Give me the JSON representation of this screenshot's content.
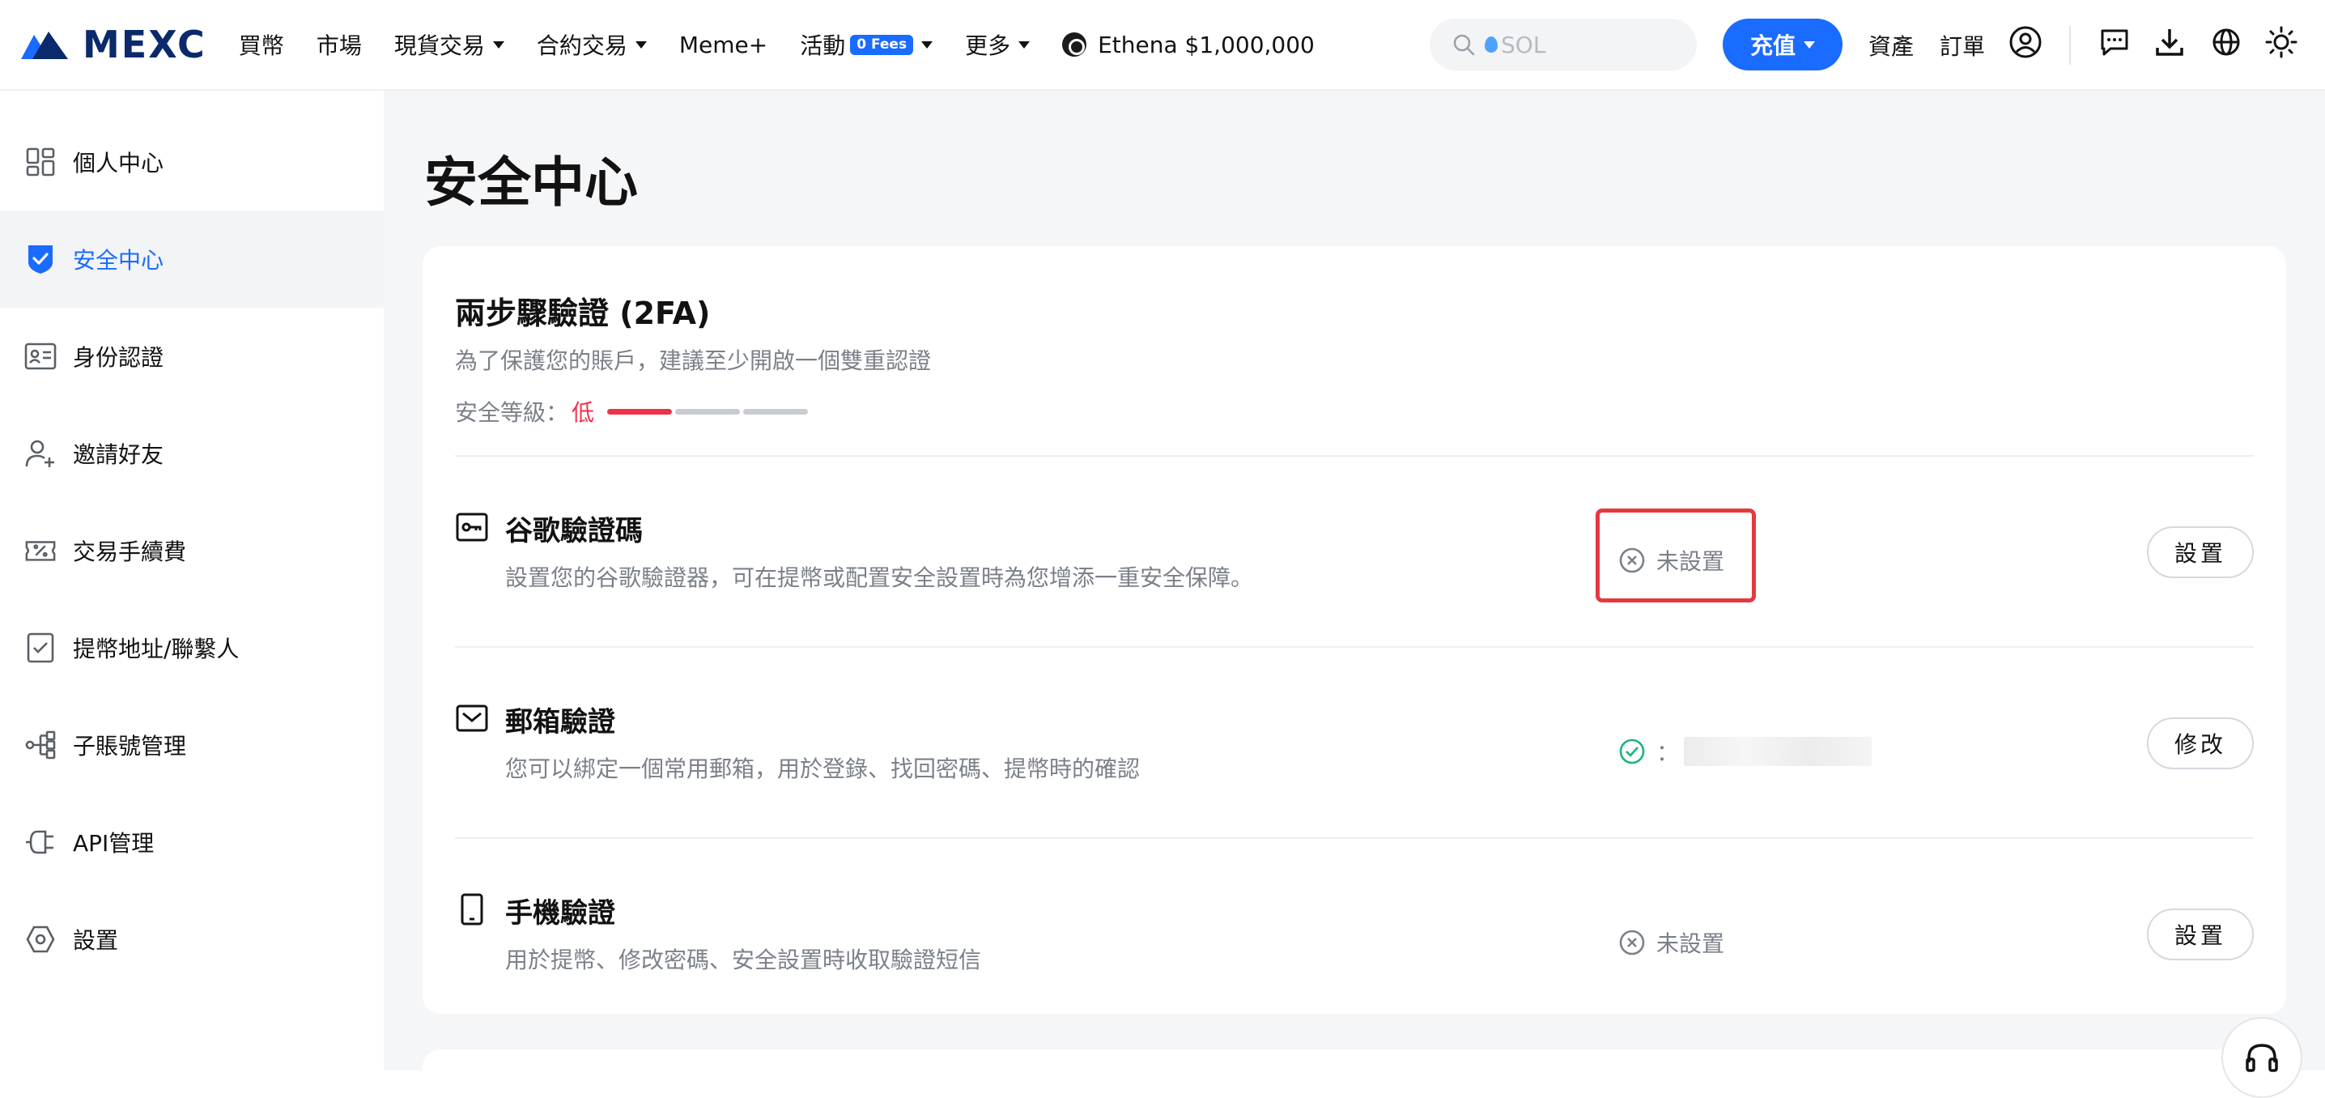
{
  "nav": {
    "brand": "MEXC",
    "items": [
      {
        "label": "買幣",
        "dropdown": false
      },
      {
        "label": "市場",
        "dropdown": false
      },
      {
        "label": "現貨交易",
        "dropdown": true
      },
      {
        "label": "合約交易",
        "dropdown": true
      },
      {
        "label": "Meme+",
        "dropdown": false
      },
      {
        "label": "活動",
        "dropdown": true,
        "badge": "0 Fees"
      },
      {
        "label": "更多",
        "dropdown": true
      }
    ],
    "promo": "Ethena $1,000,000",
    "search_placeholder": "SOL",
    "deposit_label": "充值",
    "assets_label": "資產",
    "orders_label": "訂單",
    "icons": [
      "user-icon",
      "chat-icon",
      "download-icon",
      "globe-icon",
      "sun-icon"
    ]
  },
  "sidebar": {
    "items": [
      {
        "label": "個人中心",
        "icon": "dashboard-icon",
        "active": false
      },
      {
        "label": "安全中心",
        "icon": "shield-icon",
        "active": true
      },
      {
        "label": "身份認證",
        "icon": "id-card-icon",
        "active": false
      },
      {
        "label": "邀請好友",
        "icon": "add-user-icon",
        "active": false
      },
      {
        "label": "交易手續費",
        "icon": "fee-ticket-icon",
        "active": false
      },
      {
        "label": "提幣地址/聯繫人",
        "icon": "address-book-icon",
        "active": false
      },
      {
        "label": "子賬號管理",
        "icon": "sub-account-icon",
        "active": false
      },
      {
        "label": "API管理",
        "icon": "api-plug-icon",
        "active": false
      },
      {
        "label": "設置",
        "icon": "settings-icon",
        "active": false
      }
    ]
  },
  "main": {
    "page_title": "安全中心",
    "twofa": {
      "title": "兩步驟驗證 (2FA)",
      "subtitle": "為了保護您的賬戶，建議至少開啟一個雙重認證",
      "level_label": "安全等級：",
      "level_value": "低",
      "level_segments_filled": 1,
      "level_segments_total": 3
    },
    "rows": [
      {
        "title": "谷歌驗證碼",
        "desc": "設置您的谷歌驗證器，可在提幣或配置安全設置時為您增添一重安全保障。",
        "icon": "key-icon",
        "status": "未設置",
        "status_icon": "x-circle-icon",
        "action": "設置",
        "highlighted": true
      },
      {
        "title": "郵箱驗證",
        "desc": "您可以綁定一個常用郵箱，用於登錄、找回密碼、提幣時的確認",
        "icon": "mail-icon",
        "status": "：",
        "status_icon": "check-circle-icon",
        "action": "修改",
        "highlighted": false
      },
      {
        "title": "手機驗證",
        "desc": "用於提幣、修改密碼、安全設置時收取驗證短信",
        "icon": "phone-icon",
        "status": "未設置",
        "status_icon": "x-circle-icon",
        "action": "設置",
        "highlighted": false
      }
    ]
  },
  "colors": {
    "brand_blue": "#1a6bff",
    "danger": "#f0314c",
    "success": "#1db47a",
    "highlight_box": "#e5393f"
  }
}
